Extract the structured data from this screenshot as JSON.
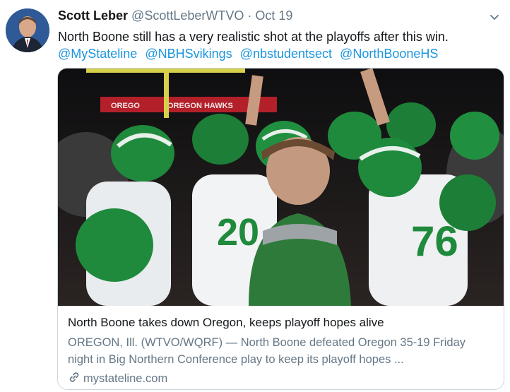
{
  "tweet": {
    "author_name": "Scott Leber",
    "author_handle": "@ScottLeberWTVO",
    "separator": "·",
    "date": "Oct 19",
    "text": "North Boone still has a very realistic shot at the playoffs after this win.",
    "mentions": [
      "@MyStateline",
      "@NBHSvikings",
      "@nbstudentsect",
      "@NorthBooneHS"
    ]
  },
  "card": {
    "title": "North Boone takes down Oregon, keeps playoff hopes alive",
    "description": "OREGON, Ill. (WTVO/WQRF) — North Boone defeated Oregon 35-19 Friday night in Big Northern Conference play to keep its playoff hopes ...",
    "domain": "mystateline.com",
    "image_text": {
      "banner": "OREGON HAWKS",
      "banner_left": "OREGO",
      "jersey_numbers": [
        "20",
        "76"
      ]
    }
  },
  "colors": {
    "link": "#1b95e0",
    "secondary_text": "#657786",
    "border": "#ccd6dd",
    "team_green": "#1f8a3c"
  },
  "icons": [
    "avatar-photo",
    "chevron-down-icon",
    "link-icon"
  ]
}
